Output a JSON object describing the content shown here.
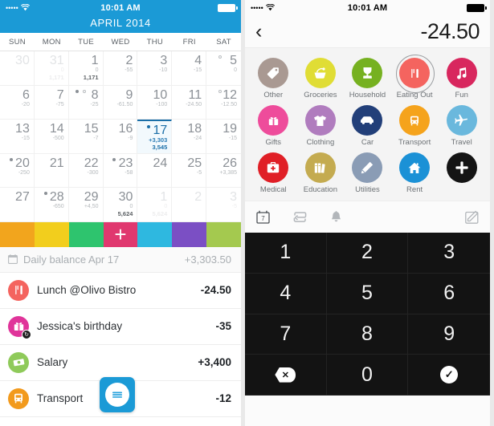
{
  "left": {
    "statusbar": {
      "signal": "•••••",
      "wifi": "wifi-icon",
      "time": "10:01 AM",
      "battery": "battery-full-icon"
    },
    "month_title": "APRIL 2014",
    "weekdays": [
      "SUN",
      "MON",
      "TUE",
      "WED",
      "THU",
      "FRI",
      "SAT"
    ],
    "days": [
      {
        "num": "30",
        "v1": "",
        "v2": "",
        "muted": true,
        "dot": ""
      },
      {
        "num": "31",
        "v1": "0",
        "v2": "1,171",
        "muted": true,
        "dot": ""
      },
      {
        "num": "1",
        "v1": "0",
        "v2": "1,171",
        "muted": false,
        "dot": ""
      },
      {
        "num": "2",
        "v1": "-55",
        "v2": "",
        "muted": false,
        "dot": ""
      },
      {
        "num": "3",
        "v1": "-10",
        "v2": "",
        "muted": false,
        "dot": ""
      },
      {
        "num": "4",
        "v1": "-15",
        "v2": "",
        "muted": false,
        "dot": ""
      },
      {
        "num": "5",
        "v1": "0",
        "v2": "",
        "muted": false,
        "dot": "hollow"
      },
      {
        "num": "6",
        "v1": "-20",
        "v2": "",
        "muted": false,
        "dot": ""
      },
      {
        "num": "7",
        "v1": "-75",
        "v2": "",
        "muted": false,
        "dot": ""
      },
      {
        "num": "8",
        "v1": "-25",
        "v2": "",
        "muted": false,
        "dot": "both"
      },
      {
        "num": "9",
        "v1": "-61.50",
        "v2": "",
        "muted": false,
        "dot": ""
      },
      {
        "num": "10",
        "v1": "-100",
        "v2": "",
        "muted": false,
        "dot": ""
      },
      {
        "num": "11",
        "v1": "-24.50",
        "v2": "",
        "muted": false,
        "dot": ""
      },
      {
        "num": "12",
        "v1": "-12.50",
        "v2": "",
        "muted": false,
        "dot": "hollow"
      },
      {
        "num": "13",
        "v1": "-15",
        "v2": "",
        "muted": false,
        "dot": ""
      },
      {
        "num": "14",
        "v1": "-500",
        "v2": "",
        "muted": false,
        "dot": ""
      },
      {
        "num": "15",
        "v1": "-7",
        "v2": "",
        "muted": false,
        "dot": ""
      },
      {
        "num": "16",
        "v1": "-9",
        "v2": "",
        "muted": false,
        "dot": ""
      },
      {
        "num": "17",
        "v1": "+3,303",
        "v2": "3,545",
        "muted": false,
        "dot": "filled",
        "today": true
      },
      {
        "num": "18",
        "v1": "-24",
        "v2": "",
        "muted": false,
        "dot": ""
      },
      {
        "num": "19",
        "v1": "-15",
        "v2": "",
        "muted": false,
        "dot": ""
      },
      {
        "num": "20",
        "v1": "-250",
        "v2": "",
        "muted": false,
        "dot": "filled"
      },
      {
        "num": "21",
        "v1": "",
        "v2": "",
        "muted": false,
        "dot": ""
      },
      {
        "num": "22",
        "v1": "-300",
        "v2": "",
        "muted": false,
        "dot": ""
      },
      {
        "num": "23",
        "v1": "-58",
        "v2": "",
        "muted": false,
        "dot": "filled"
      },
      {
        "num": "24",
        "v1": "",
        "v2": "",
        "muted": false,
        "dot": ""
      },
      {
        "num": "25",
        "v1": "-5",
        "v2": "",
        "muted": false,
        "dot": ""
      },
      {
        "num": "26",
        "v1": "+3,385",
        "v2": "",
        "muted": false,
        "dot": ""
      },
      {
        "num": "27",
        "v1": "",
        "v2": "",
        "muted": false,
        "dot": ""
      },
      {
        "num": "28",
        "v1": "-650",
        "v2": "",
        "muted": false,
        "dot": "filled"
      },
      {
        "num": "29",
        "v1": "+4,50",
        "v2": "",
        "muted": false,
        "dot": ""
      },
      {
        "num": "30",
        "v1": "0",
        "v2": "5,624",
        "muted": false,
        "dot": ""
      },
      {
        "num": "1",
        "v1": "0",
        "v2": "5,624",
        "muted": true,
        "dot": ""
      },
      {
        "num": "2",
        "v1": "",
        "v2": "",
        "muted": true,
        "dot": ""
      },
      {
        "num": "3",
        "v1": "-5",
        "v2": "",
        "muted": true,
        "dot": ""
      }
    ],
    "color_strip": {
      "colors": [
        "#f2a51d",
        "#f2ce1d",
        "#2ec46e",
        "#e0386f",
        "#2eb8e0",
        "#7b4fc4",
        "#a4c94f"
      ],
      "add_label": "+",
      "add_index": 3
    },
    "daily_balance": {
      "icon": "calendar-icon",
      "label": "Daily balance Apr 17",
      "amount": "+3,303.50"
    },
    "transactions": [
      {
        "icon": "cutlery-icon",
        "color": "#f4645f",
        "name": "Lunch @Olivo Bistro",
        "amount": "-24.50",
        "badge": ""
      },
      {
        "icon": "gift-icon",
        "color": "#e0349a",
        "name": "Jessica's birthday",
        "amount": "-35",
        "badge": "recurring-badge"
      },
      {
        "icon": "money-icon",
        "color": "#8fca5a",
        "name": "Salary",
        "amount": "+3,400",
        "badge": ""
      },
      {
        "icon": "train-icon",
        "color": "#f29a1d",
        "name": "Transport",
        "amount": "-12",
        "badge": ""
      }
    ],
    "fab": {
      "name": "compose-list-button",
      "color": "#1b9ad6"
    }
  },
  "right": {
    "statusbar": {
      "signal": "•••••",
      "wifi": "wifi-icon",
      "time": "10:01 AM",
      "battery": "battery-full-icon"
    },
    "nav": {
      "back": "back-chevron-icon",
      "amount": "-24.50"
    },
    "categories": [
      {
        "label": "Other",
        "icon": "tag-icon",
        "color": "#a99992",
        "selected": false
      },
      {
        "label": "Groceries",
        "icon": "basket-icon",
        "color": "#e0dd35",
        "selected": false
      },
      {
        "label": "Household",
        "icon": "blender-icon",
        "color": "#76b120",
        "selected": false
      },
      {
        "label": "Eating Out",
        "icon": "cutlery-icon",
        "color": "#f4645f",
        "selected": true
      },
      {
        "label": "Fun",
        "icon": "music-icon",
        "color": "#d8275e",
        "selected": false
      },
      {
        "label": "Gifts",
        "icon": "gift-icon",
        "color": "#ee4c9b",
        "selected": false
      },
      {
        "label": "Clothing",
        "icon": "tshirt-icon",
        "color": "#b07cbe",
        "selected": false
      },
      {
        "label": "Car",
        "icon": "car-icon",
        "color": "#223f79",
        "selected": false
      },
      {
        "label": "Transport",
        "icon": "train-icon",
        "color": "#f5a31c",
        "selected": false
      },
      {
        "label": "Travel",
        "icon": "plane-icon",
        "color": "#6ab8dd",
        "selected": false
      },
      {
        "label": "Medical",
        "icon": "firstaid-icon",
        "color": "#e01f26",
        "selected": false
      },
      {
        "label": "Education",
        "icon": "books-icon",
        "color": "#c4ab50",
        "selected": false
      },
      {
        "label": "Utilities",
        "icon": "pencil-icon",
        "color": "#8a9cb5",
        "selected": false
      },
      {
        "label": "Rent",
        "icon": "home-icon",
        "color": "#1b91d6",
        "selected": false
      },
      {
        "label": "",
        "icon": "plus-icon",
        "color": "#141414",
        "selected": false
      }
    ],
    "toolbar": [
      {
        "name": "date-picker-icon",
        "glyph": "calendar-7-icon"
      },
      {
        "name": "repeat-icon",
        "glyph": "repeat-icon"
      },
      {
        "name": "reminder-icon",
        "glyph": "bell-icon"
      },
      {
        "name": "note-icon",
        "glyph": "compose-icon"
      }
    ],
    "keypad": [
      "1",
      "2",
      "3",
      "4",
      "5",
      "6",
      "7",
      "8",
      "9",
      "delete-key",
      "0",
      "confirm-key"
    ]
  }
}
